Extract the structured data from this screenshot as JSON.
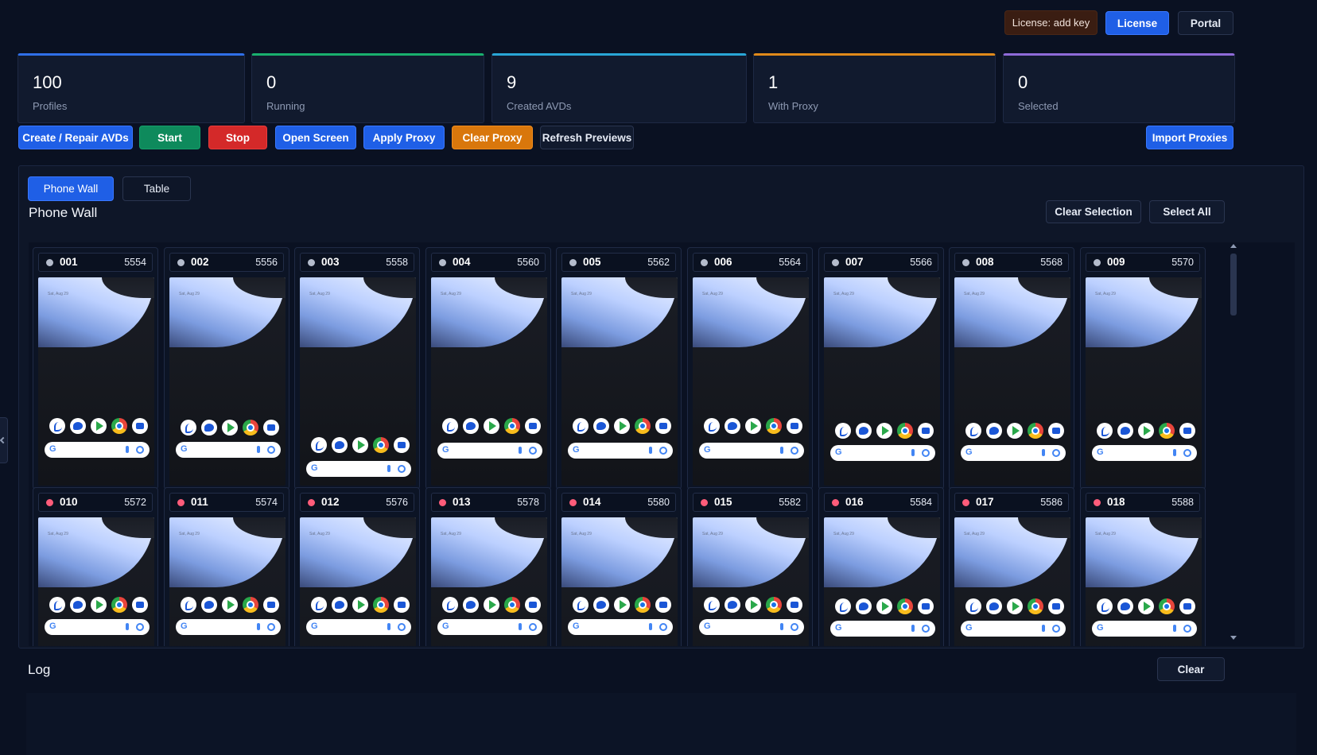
{
  "header": {
    "license_status": "License: add key",
    "license_button": "License",
    "portal_button": "Portal"
  },
  "stats": [
    {
      "value": "100",
      "label": "Profiles",
      "color": "#2f6fe8"
    },
    {
      "value": "0",
      "label": "Running",
      "color": "#19b06e"
    },
    {
      "value": "9",
      "label": "Created AVDs",
      "color": "#29a6d6"
    },
    {
      "value": "1",
      "label": "With Proxy",
      "color": "#e08a1a"
    },
    {
      "value": "0",
      "label": "Selected",
      "color": "#8f6ad8"
    }
  ],
  "toolbar": {
    "create_repair": "Create / Repair AVDs",
    "start": "Start",
    "stop": "Stop",
    "open_screen": "Open Screen",
    "apply_proxy": "Apply Proxy",
    "clear_proxy": "Clear Proxy",
    "refresh_previews": "Refresh Previews",
    "import_proxies": "Import Proxies"
  },
  "view_tabs": {
    "phone_wall": "Phone Wall",
    "table": "Table"
  },
  "wall": {
    "title": "Phone Wall",
    "clear_selection": "Clear Selection",
    "select_all": "Select All",
    "phones": [
      {
        "id": "001",
        "port": "5554",
        "status": "gray"
      },
      {
        "id": "002",
        "port": "5556",
        "status": "gray"
      },
      {
        "id": "003",
        "port": "5558",
        "status": "gray"
      },
      {
        "id": "004",
        "port": "5560",
        "status": "gray"
      },
      {
        "id": "005",
        "port": "5562",
        "status": "gray"
      },
      {
        "id": "006",
        "port": "5564",
        "status": "gray"
      },
      {
        "id": "007",
        "port": "5566",
        "status": "gray"
      },
      {
        "id": "008",
        "port": "5568",
        "status": "gray"
      },
      {
        "id": "009",
        "port": "5570",
        "status": "gray"
      },
      {
        "id": "010",
        "port": "5572",
        "status": "pink"
      },
      {
        "id": "011",
        "port": "5574",
        "status": "pink"
      },
      {
        "id": "012",
        "port": "5576",
        "status": "pink"
      },
      {
        "id": "013",
        "port": "5578",
        "status": "pink"
      },
      {
        "id": "014",
        "port": "5580",
        "status": "pink"
      },
      {
        "id": "015",
        "port": "5582",
        "status": "pink"
      },
      {
        "id": "016",
        "port": "5584",
        "status": "pink"
      },
      {
        "id": "017",
        "port": "5586",
        "status": "pink"
      },
      {
        "id": "018",
        "port": "5588",
        "status": "pink"
      }
    ],
    "screen_date": "Sat, Aug 29"
  },
  "log": {
    "title": "Log",
    "clear": "Clear"
  }
}
